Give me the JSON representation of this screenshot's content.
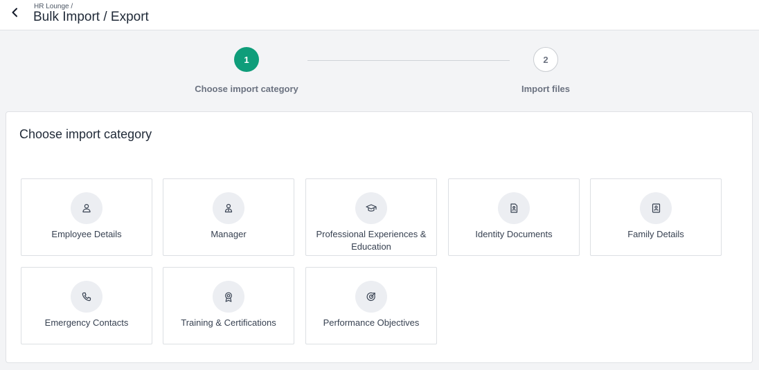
{
  "header": {
    "breadcrumb_parent": "HR Lounge /",
    "title": "Bulk Import / Export"
  },
  "stepper": {
    "steps": [
      {
        "number": "1",
        "label": "Choose import category",
        "state": "active"
      },
      {
        "number": "2",
        "label": "Import files",
        "state": "pending"
      }
    ]
  },
  "main": {
    "section_title": "Choose import category",
    "categories": [
      {
        "label": "Employee Details",
        "icon": "user-icon"
      },
      {
        "label": "Manager",
        "icon": "manager-icon"
      },
      {
        "label": "Professional Experiences & Education",
        "icon": "graduation-cap-icon"
      },
      {
        "label": "Identity Documents",
        "icon": "id-document-icon"
      },
      {
        "label": "Family Details",
        "icon": "contact-card-icon"
      },
      {
        "label": "Emergency Contacts",
        "icon": "phone-icon"
      },
      {
        "label": "Training & Certifications",
        "icon": "award-icon"
      },
      {
        "label": "Performance Objectives",
        "icon": "target-icon"
      }
    ]
  },
  "colors": {
    "accent": "#0f9d7a",
    "page_background": "#f3f4f6",
    "icon_background": "#eceef2"
  }
}
